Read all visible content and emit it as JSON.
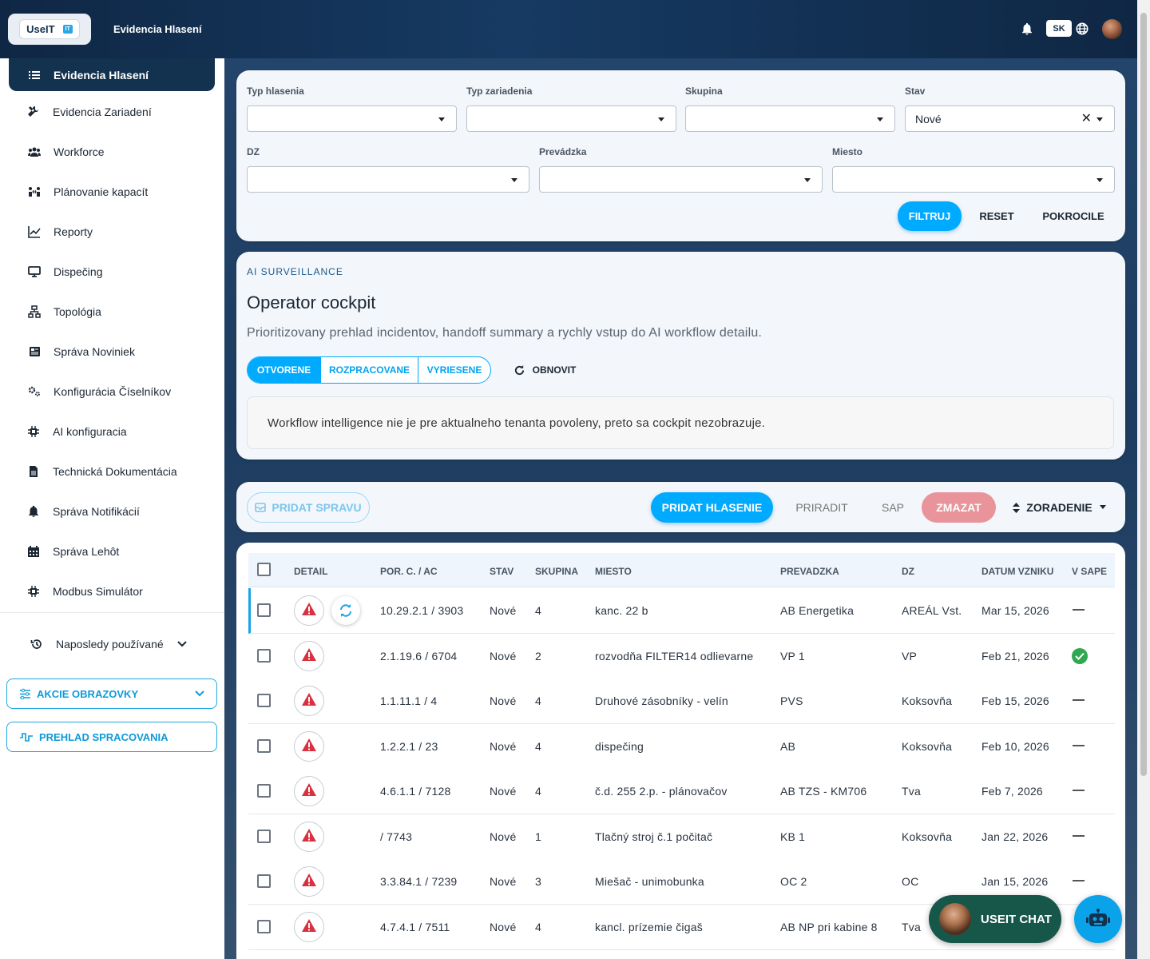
{
  "app": {
    "logo_text": "UseIT",
    "logo_badge": "IT",
    "page_title": "Evidencia Hlasení",
    "lang": "SK"
  },
  "sidebar": {
    "active": "Evidencia Hlasení",
    "items": [
      "Evidencia Zariadení",
      "Workforce",
      "Plánovanie kapacít",
      "Reporty",
      "Dispečing",
      "Topológia",
      "Správa Noviniek",
      "Konfigurácia Číselníkov",
      "AI konfiguracia",
      "Technická Dokumentácia",
      "Správa Notifikácií",
      "Správa Lehôt",
      "Modbus Simulátor"
    ],
    "icons": [
      "tools-icon",
      "users-icon",
      "capacity-icon",
      "chart-line-icon",
      "monitor-icon",
      "network-icon",
      "news-icon",
      "cogs-icon",
      "chip-icon",
      "document-icon",
      "bell-icon",
      "calendar-icon",
      "chip-icon"
    ],
    "recent": "Naposledy používané",
    "screen_actions": "AKCIE OBRAZOVKY",
    "processing": "PREHLAD SPRACOVANIA"
  },
  "filters": {
    "typ_hlasenia": {
      "label": "Typ hlasenia",
      "value": ""
    },
    "typ_zariadenia": {
      "label": "Typ zariadenia",
      "value": ""
    },
    "skupina": {
      "label": "Skupina",
      "value": ""
    },
    "stav": {
      "label": "Stav",
      "value": "Nové"
    },
    "dz": {
      "label": "DZ",
      "value": ""
    },
    "prevadzka": {
      "label": "Prevádzka",
      "value": ""
    },
    "miesto": {
      "label": "Miesto",
      "value": ""
    },
    "filter_btn": "FILTRUJ",
    "reset_btn": "RESET",
    "advanced_btn": "POKROCILE"
  },
  "cockpit": {
    "overline": "AI SURVEILLANCE",
    "title": "Operator cockpit",
    "description": "Prioritizovany prehlad incidentov, handoff summary a rychly vstup do AI workflow detailu.",
    "tabs": [
      "OTVORENE",
      "ROZPRACOVANE",
      "VYRIESENE"
    ],
    "refresh": "OBNOVIT",
    "notice": "Workflow intelligence nie je pre aktualneho tenanta povoleny, preto sa cockpit nezobrazuje."
  },
  "toolbar": {
    "add_message": "PRIDAT SPRAVU",
    "add_report": "PRIDAT HLASENIE",
    "assign": "PRIRADIT",
    "sap": "SAP",
    "delete": "ZMAZAT",
    "sort": "ZORADENIE"
  },
  "table": {
    "headers": {
      "detail": "DETAIL",
      "por": "POR. C. / AC",
      "stav": "STAV",
      "skupina": "SKUPINA",
      "miesto": "MIESTO",
      "prevadzka": "PREVADZKA",
      "dz": "DZ",
      "datum": "DATUM VZNIKU",
      "sap": "V SAPE"
    },
    "rows": [
      {
        "por": "10.29.2.1 / 3903",
        "stav": "Nové",
        "skupina": "4",
        "miesto": "kanc. 22 b",
        "prevadzka": "AB Energetika",
        "dz": "AREÁL Vst.",
        "datum": "Mar 15, 2026",
        "sap": false
      },
      {
        "por": "2.1.19.6 / 6704",
        "stav": "Nové",
        "skupina": "2",
        "miesto": "rozvodňa FILTER14 odlievarne",
        "prevadzka": "VP 1",
        "dz": "VP",
        "datum": "Feb 21, 2026",
        "sap": true
      },
      {
        "por": "1.1.11.1 / 4",
        "stav": "Nové",
        "skupina": "4",
        "miesto": "Druhové zásobníky - velín",
        "prevadzka": "PVS",
        "dz": "Koksovňa",
        "datum": "Feb 15, 2026",
        "sap": false
      },
      {
        "por": "1.2.2.1 / 23",
        "stav": "Nové",
        "skupina": "4",
        "miesto": "dispečing",
        "prevadzka": "AB",
        "dz": "Koksovňa",
        "datum": "Feb 10, 2026",
        "sap": false
      },
      {
        "por": "4.6.1.1 / 7128",
        "stav": "Nové",
        "skupina": "4",
        "miesto": "č.d. 255 2.p. - plánovačov",
        "prevadzka": "AB TZS - KM706",
        "dz": "Tva",
        "datum": "Feb 7, 2026",
        "sap": false
      },
      {
        "por": "/ 7743",
        "stav": "Nové",
        "skupina": "1",
        "miesto": "Tlačný stroj č.1 počitač",
        "prevadzka": "KB 1",
        "dz": "Koksovňa",
        "datum": "Jan 22, 2026",
        "sap": false
      },
      {
        "por": "3.3.84.1 / 7239",
        "stav": "Nové",
        "skupina": "3",
        "miesto": "Miešač - unimobunka",
        "prevadzka": "OC 2",
        "dz": "OC",
        "datum": "Jan 15, 2026",
        "sap": false
      },
      {
        "por": "4.7.4.1 / 7511",
        "stav": "Nové",
        "skupina": "4",
        "miesto": "kancl. prízemie čigaš",
        "prevadzka": "AB NP pri kabine 8",
        "dz": "Tva",
        "datum": "",
        "sap": null
      }
    ]
  },
  "chat": {
    "label": "USEIT CHAT"
  }
}
